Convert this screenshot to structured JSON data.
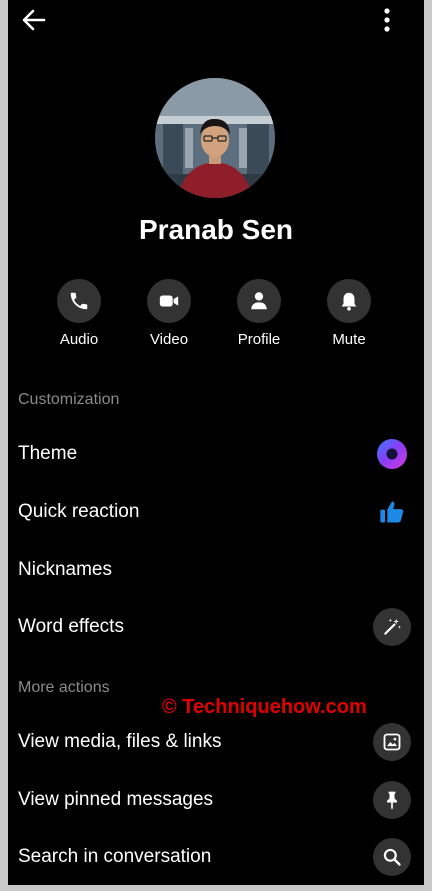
{
  "profile": {
    "name": "Pranab Sen"
  },
  "actions": [
    {
      "label": "Audio",
      "icon": "phone-icon"
    },
    {
      "label": "Video",
      "icon": "video-icon"
    },
    {
      "label": "Profile",
      "icon": "person-icon"
    },
    {
      "label": "Mute",
      "icon": "bell-icon"
    }
  ],
  "customization": {
    "title": "Customization",
    "items": [
      {
        "label": "Theme",
        "icon": "theme-color-icon"
      },
      {
        "label": "Quick reaction",
        "icon": "thumbs-up-icon"
      },
      {
        "label": "Nicknames",
        "icon": ""
      },
      {
        "label": "Word effects",
        "icon": "magic-wand-icon"
      }
    ]
  },
  "more_actions": {
    "title": "More actions",
    "items": [
      {
        "label": "View media, files & links",
        "icon": "image-icon"
      },
      {
        "label": "View pinned messages",
        "icon": "pin-icon"
      },
      {
        "label": "Search in conversation",
        "icon": "search-icon"
      }
    ]
  },
  "watermark": "© Techniquehow.com",
  "colors": {
    "background": "#000000",
    "icon_circle": "#333333",
    "theme_accent_outer": "#6b4cf6",
    "theme_accent_inner": "#1a1a40",
    "thumbs_up": "#1e88e5",
    "watermark": "#e10000"
  }
}
